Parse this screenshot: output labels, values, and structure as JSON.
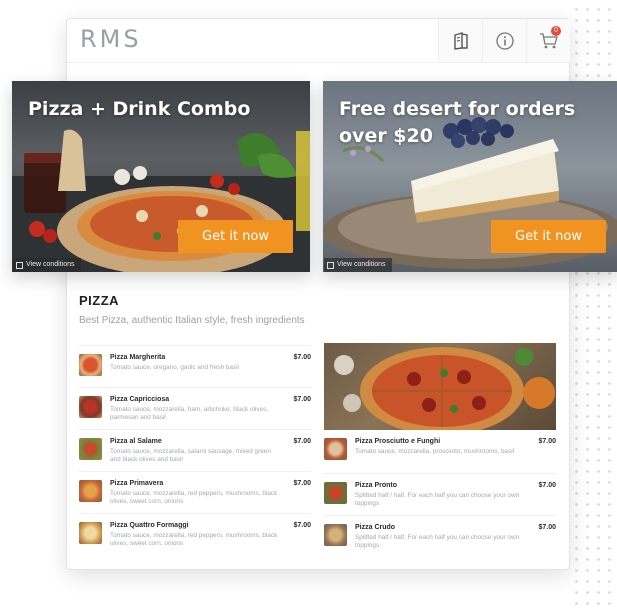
{
  "app": {
    "logo": "RMS"
  },
  "header": {
    "cart_count": "0"
  },
  "banners": [
    {
      "title": "Pizza + Drink Combo",
      "cta": "Get it now",
      "conditions": "View conditions"
    },
    {
      "title": "Free desert for orders over $20",
      "cta": "Get it now",
      "conditions": "View conditions"
    }
  ],
  "section": {
    "title": "PIZZA",
    "subtitle": "Best Pizza, authentic Italian style, fresh ingredients"
  },
  "menu": {
    "left": [
      {
        "name": "Pizza Margherita",
        "desc": "Tomato sauce, oregano, garlic and fresh basil",
        "price": "$7.00"
      },
      {
        "name": "Pizza Capricciosa",
        "desc": "Tomato sauce, mozzarella, ham, artichoke, black olives, parmesan and basil",
        "price": "$7.00"
      },
      {
        "name": "Pizza al Salame",
        "desc": "Tomato sauce, mozzarella, salami sausage, mixed green and black olives and basil",
        "price": "$7.00"
      },
      {
        "name": "Pizza Primavera",
        "desc": "Tomato sauce, mozzarella, red peppers, mushrooms, black olives, sweet corn, onions",
        "price": "$7.00"
      },
      {
        "name": "Pizza Quattro Formaggi",
        "desc": "Tomato sauce, mozzarella, red peppers, mushrooms, black olives, sweet corn, onions",
        "price": "$7.00"
      }
    ],
    "right": [
      {
        "name": "Pizza Prosciutto e Funghi",
        "desc": "Tomato sauce, mozzarella, prosciutto, mushrooms, basil",
        "price": "$7.00"
      },
      {
        "name": "Pizza Pronto",
        "desc": "Splitted half / half. For each half you can choose your own toppings",
        "price": "$7.00"
      },
      {
        "name": "Pizza Crudo",
        "desc": "Splitted half / half. For each half you can choose your own toppings",
        "price": "$7.00"
      }
    ]
  },
  "colors": {
    "accent": "#f19321",
    "badge": "#e34b3a"
  }
}
